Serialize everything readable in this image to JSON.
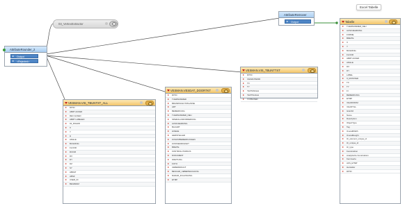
{
  "tooltip": "Excel Tabelle",
  "nodes": {
    "attribute_rounder": {
      "title": "AttributeRounder_2",
      "ports": [
        "Output",
        "<Rejected>"
      ]
    },
    "vertex_extractor": {
      "title": "03_VertexExtractor"
    },
    "attribute_remover": {
      "title": "AttributeRemover",
      "ports": [
        "Output"
      ]
    },
    "tabelle": {
      "title": "Tabelle",
      "rows": [
        "TUERNUMMER_NEU",
        "AUSFUEHRUNG",
        "FORME",
        "BREITE",
        "X",
        "Y",
        "BUILDING",
        "FLOOR",
        "ABRT ACKED",
        "ANGLE",
        "DX",
        "DY",
        "LABEL",
        "X_ROTATED",
        "TX",
        "TY",
        "FI",
        "BEMERKUNG",
        "ETMP",
        "VALIDFROM",
        "VALIDTILL",
        "Glutz32",
        "Name",
        "Description",
        "ObjectType",
        "Tag",
        "OverallWidth",
        "OverallHeight",
        "ifc_element_unique_id",
        "ifc_unique_id",
        "ifc_type",
        "Konstruktion",
        "Analytische Konstruktion",
        "Kennwerte",
        "AKS_ETMP",
        "Hersteller",
        "RITID"
      ]
    },
    "vis_tbuntxt": {
      "title": "VESMAN.VIS_TBUNTTXT",
      "rows": [
        "RITID",
        "VARIANTENID",
        "TX",
        "TY",
        "TEXTANGLE",
        "TEXTSCALE",
        "TXTBOXED"
      ]
    },
    "vesdat_door": {
      "title": "VESMAN.VESDAT_DOORTKT",
      "rows": [
        "RITID",
        "TUERNUMMER",
        "BRANDSCHUTZKLASSE",
        "ART",
        "BEMERKUNG",
        "TUERNUMMER_NEU",
        "SPEZIALANFORDERUNG",
        "AUSFUEHRUNG",
        "BAUART",
        "HOEHE",
        "HERSTELLER",
        "ZUSATZBEMERKUNGEN",
        "ZUSTAENDIGKEIT",
        "BREITE",
        "KONTROLLTURNUS",
        "DOKUMENT",
        "WARTUNG",
        "FOTO",
        "UEBERWACHT",
        "BESCHR_UEBERWACHUNG",
        "RADAR_ZULASSUNG",
        "ETMP"
      ]
    },
    "vis_tbuntxt_all": {
      "title": "VESMAN.VIS_TBUNTXT_ALL",
      "rows": [
        "RITID",
        "ABRT ACKED",
        "REV ACKED",
        "ABRT LABELED",
        "02_RIGHID",
        "X",
        "Y",
        "H",
        "ANGLE",
        "BUILDING",
        "FLOOR",
        "ROOM",
        "DX",
        "DY",
        "DZ",
        "SY",
        "ABDAT",
        "ABSZ",
        "USER_ID",
        "BEGRENZ"
      ]
    }
  }
}
